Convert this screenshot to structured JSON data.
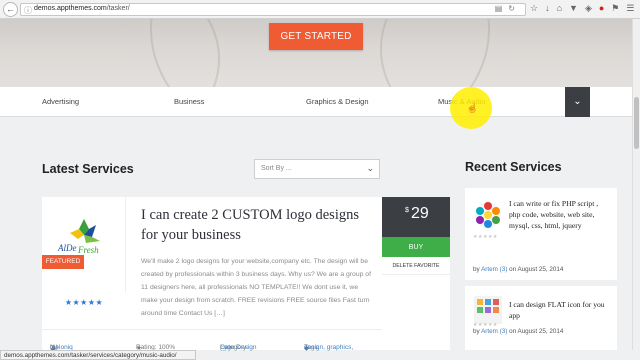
{
  "browser": {
    "url_domain": "demos.appthemes.com",
    "url_path": "/tasker/",
    "back_symbol": "←"
  },
  "hero": {
    "cta_label": "GET STARTED"
  },
  "category_nav": {
    "items": [
      "Advertising",
      "Business",
      "Graphics & Design",
      "Music & Audio"
    ],
    "toggle_symbol": "⌄"
  },
  "latest": {
    "title": "Latest Services",
    "sort_placeholder": "Sort By ...",
    "card": {
      "title": "I can create 2 CUSTOM logo designs for your business",
      "description": "We'll make 2 logo designs for your website,company etc. The design will be created by professionals within 3 business days.  Why us? We are a group of 11 designers here, all professionals NO TEMPLATE!! We dont use it, we make your design from scratch. FREE revisions FREE source files Fast turn around time Contact Us […]",
      "badge": "FEATURED",
      "logo_text": "AlDe Fresh",
      "stars": "★★★★★",
      "meta": {
        "by_label": "by",
        "author": "meloniq",
        "author_count": "(1)",
        "rating": "Rating: 100%",
        "category_label": "Category:",
        "category": "Logo Design",
        "tags_label": "Tags:",
        "tags": "design, graphics,"
      },
      "price_currency": "$",
      "price_amount": "29",
      "buy_label": "BUY",
      "delete_label": "DELETE FAVORITE"
    }
  },
  "recent": {
    "title": "Recent Services",
    "items": [
      {
        "title": "I can write or fix PHP script , php code, website, web site, mysql, css, html, jquery",
        "by_label": "by",
        "author": "Artem",
        "author_count": "(3)",
        "date": "on August 25, 2014",
        "stars": "★★★★★"
      },
      {
        "title": "I can design FLAT icon for you app",
        "by_label": "by",
        "author": "Artem",
        "author_count": "(3)",
        "date": "on August 25, 2014",
        "stars": "★★★★★"
      }
    ]
  },
  "status_bar": {
    "text": "demos.appthemes.com/tasker/services/category/music-audio/"
  },
  "colors": {
    "accent_orange": "#ef5b33",
    "buy_green": "#3fae49",
    "dark_panel": "#3b3f44",
    "link_blue": "#3f7fbf",
    "cursor_highlight": "#ffee00"
  }
}
